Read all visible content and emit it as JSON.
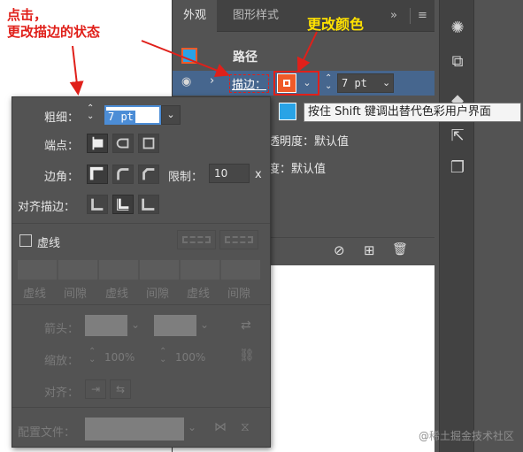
{
  "annotations": {
    "click_note_line1": "点击，",
    "click_note_line2": "更改描边的状态",
    "color_note": "更改颜色"
  },
  "appearance": {
    "tabs": [
      "外观",
      "图形样式"
    ],
    "path_label": "路径",
    "stroke_label": "描边：",
    "stroke_weight_value": "7 pt",
    "opacity1": "透明度：默认值",
    "opacity2": "度：默认值",
    "colors": {
      "stroke": "#f05a28",
      "fill_swatch": "#29a3e6",
      "highlight": "#46668e"
    }
  },
  "tooltip": "按住 Shift 键调出替代色彩用户界面",
  "stroke_panel": {
    "weight_label": "粗细：",
    "weight_value": "7 pt",
    "cap_label": "端点：",
    "corner_label": "边角：",
    "limit_label": "限制：",
    "limit_value": "10",
    "limit_unit": "x",
    "align_label": "对齐描边：",
    "dashed_label": "虚线",
    "dash_labels": [
      "虚线",
      "间隙",
      "虚线",
      "间隙",
      "虚线",
      "间隙"
    ],
    "arrow_label": "箭头：",
    "scale_label": "缩放：",
    "scale_value1": "100%",
    "scale_value2": "100%",
    "align2_label": "对齐：",
    "profile_label": "配置文件："
  },
  "watermark": "@稀土掘金技术社区"
}
